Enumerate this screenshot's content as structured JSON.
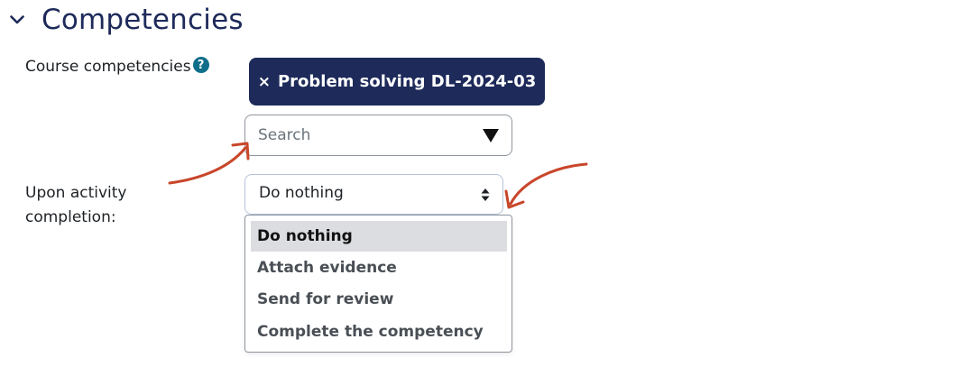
{
  "section": {
    "title": "Competencies",
    "collapse_icon": "chevron-down-icon"
  },
  "course_competencies": {
    "label": "Course competencies",
    "help_icon": "question-mark",
    "selected_tag": {
      "remove_symbol": "×",
      "label": "Problem solving DL-2024-03"
    },
    "search": {
      "placeholder": "Search",
      "value": "",
      "dropdown_icon": "caret-down-icon"
    }
  },
  "completion_action": {
    "label_line1": "Upon activity",
    "label_line2": "completion:",
    "selected_value": "Do nothing",
    "select_icon": "up-down-arrows-icon",
    "options": [
      {
        "label": "Do nothing",
        "selected": true
      },
      {
        "label": "Attach evidence",
        "selected": false
      },
      {
        "label": "Send for review",
        "selected": false
      },
      {
        "label": "Complete the competency",
        "selected": false
      }
    ]
  },
  "annotation_color": "#c8462a",
  "accent_color": "#1d2a5a"
}
